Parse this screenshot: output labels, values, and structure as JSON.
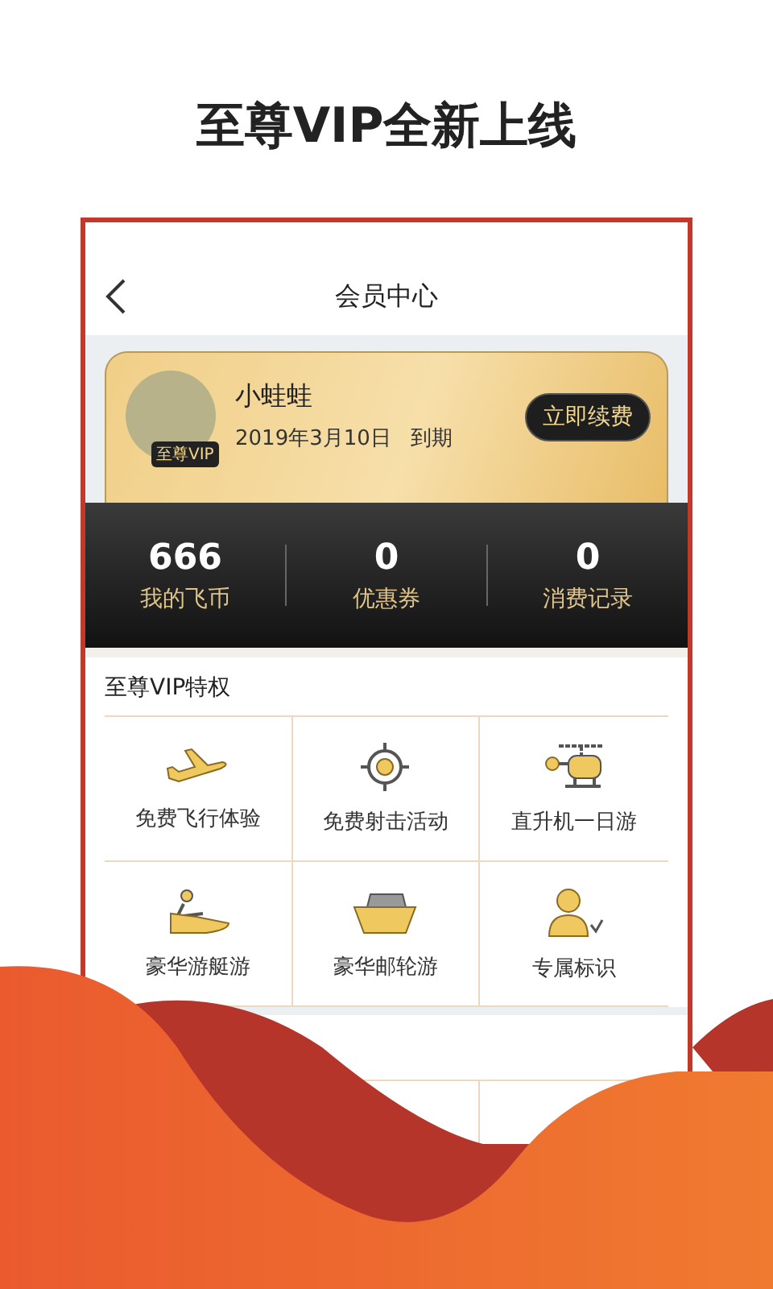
{
  "headline": "至尊VIP全新上线",
  "nav": {
    "title": "会员中心"
  },
  "member": {
    "name": "小蛙蛙",
    "badge": "至尊VIP",
    "expiry": "2019年3月10日",
    "expiry_suffix": "到期",
    "renew_button": "立即续费"
  },
  "stats": [
    {
      "value": "666",
      "label": "我的飞币"
    },
    {
      "value": "0",
      "label": "优惠券"
    },
    {
      "value": "0",
      "label": "消费记录"
    }
  ],
  "privileges": {
    "title": "至尊VIP特权",
    "items": [
      {
        "kind": "plane",
        "label": "免费飞行体验"
      },
      {
        "kind": "target",
        "label": "免费射击活动"
      },
      {
        "kind": "helicopter",
        "label": "直升机一日游"
      },
      {
        "kind": "boat",
        "label": "豪华游艇游"
      },
      {
        "kind": "ship",
        "label": "豪华邮轮游"
      },
      {
        "kind": "person",
        "label": "专属标识"
      }
    ]
  }
}
